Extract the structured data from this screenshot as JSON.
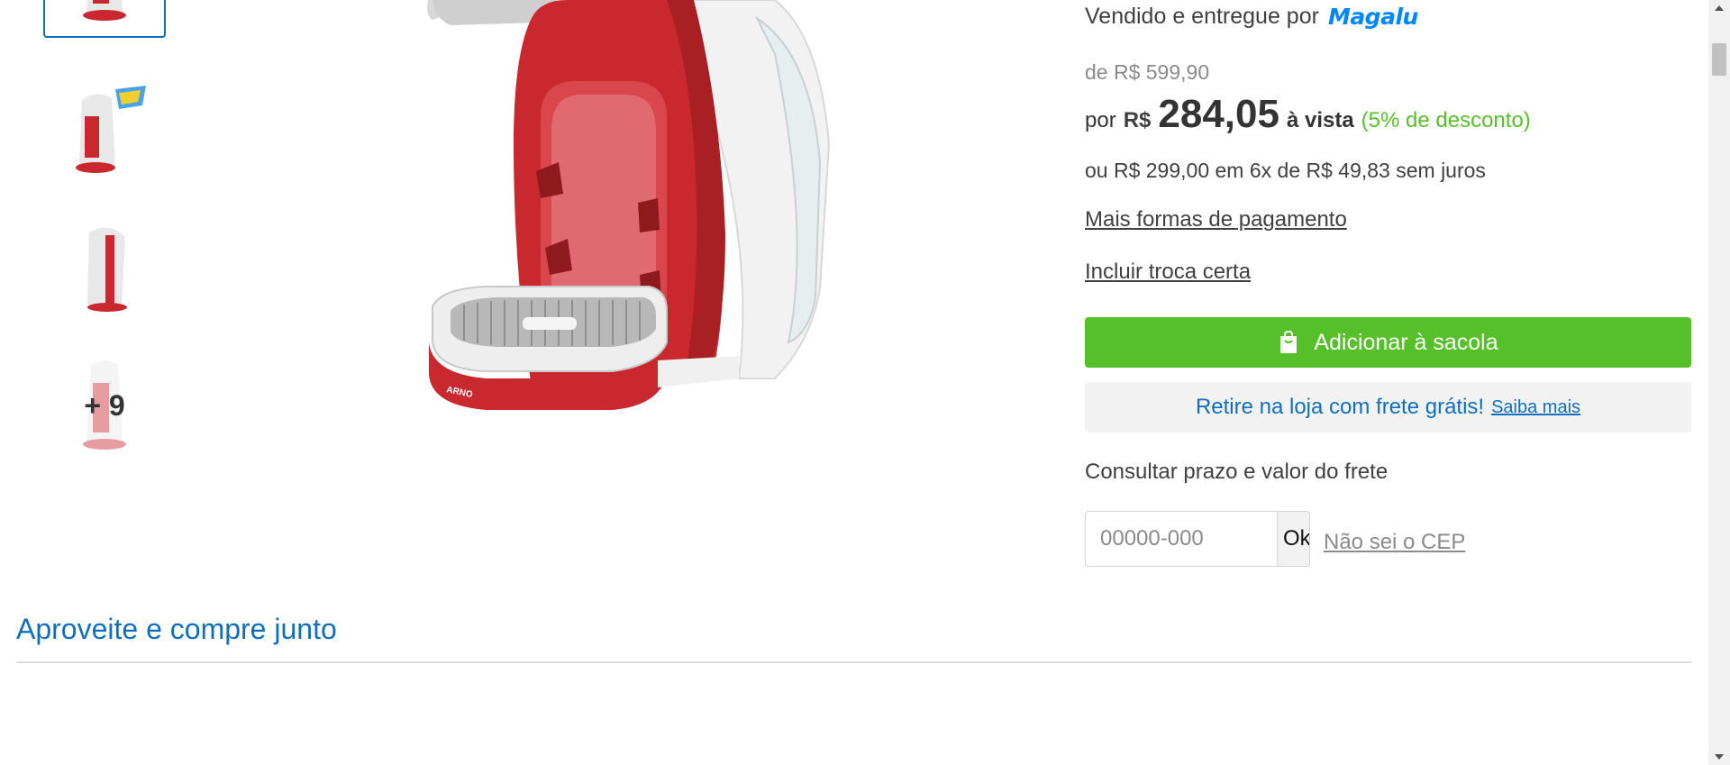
{
  "gallery": {
    "more_count": "+ 9"
  },
  "seller": {
    "sold_by_label": "Vendido e entregue por",
    "seller_logo_text": "Magalu"
  },
  "price": {
    "old": "de R$ 599,90",
    "por_label": "por",
    "currency": "R$",
    "value": "284,05",
    "avista_label": "à vista",
    "discount": "(5% de desconto)",
    "installments": "ou R$ 299,00 em 6x de R$ 49,83 sem juros"
  },
  "links": {
    "payment_options": "Mais formas de pagamento",
    "include_exchange": "Incluir troca certa"
  },
  "actions": {
    "add_to_bag": "Adicionar à sacola",
    "pickup_text": "Retire na loja com frete grátis!",
    "pickup_link": "Saiba mais"
  },
  "shipping": {
    "title": "Consultar prazo e valor do frete",
    "cep_placeholder": "00000-000",
    "ok_label": "Ok",
    "unknown_cep": "Não sei o CEP"
  },
  "section": {
    "title": "Aproveite e compre junto"
  },
  "colors": {
    "accent_green": "#56c02b",
    "link_blue": "#0f6fbf",
    "brand_blue": "#0086ff",
    "product_red": "#c8282e"
  }
}
